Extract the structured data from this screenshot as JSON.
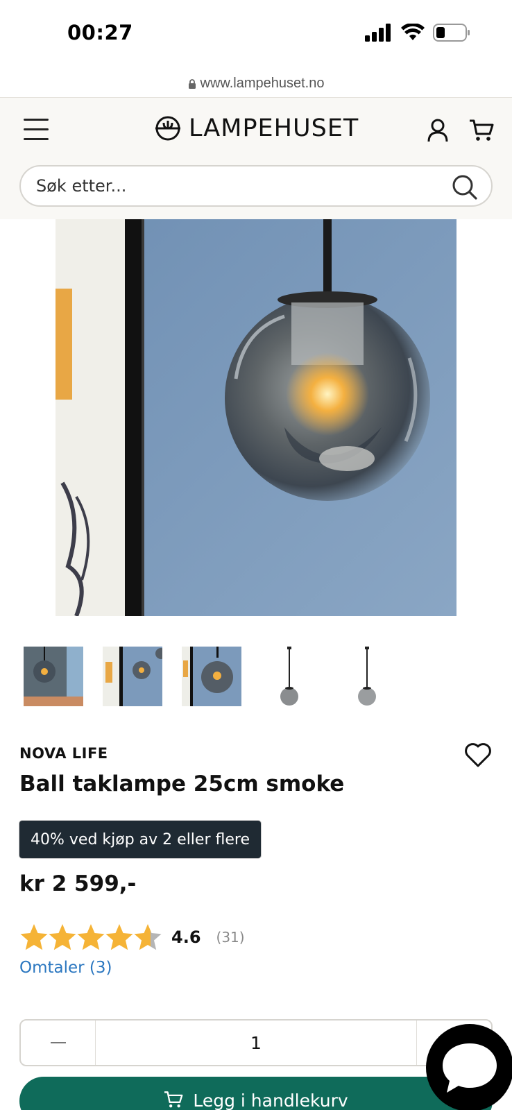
{
  "status_bar": {
    "time": "00:27"
  },
  "browser": {
    "url": "www.lampehuset.no"
  },
  "header": {
    "logo_text": "LAMPEHUSET",
    "search_placeholder": "Søk etter..."
  },
  "product": {
    "brand": "NOVA LIFE",
    "title": "Ball taklampe 25cm smoke",
    "promo": "40% ved kjøp av 2 eller flere",
    "price": "kr 2 599,-",
    "rating": {
      "value": "4.6",
      "stars": 4.6,
      "count": "(31)"
    },
    "reviews_link": "Omtaler (3)",
    "quantity": "1",
    "add_to_cart": "Legg i handlekurv",
    "thumbnails": [
      "thumb-1",
      "thumb-2",
      "thumb-3",
      "thumb-4",
      "thumb-5"
    ]
  },
  "colors": {
    "header_bg": "#f9f8f5",
    "promo_bg": "#1f2a33",
    "cart_button": "#0f6b5a",
    "link": "#2b77c0",
    "star": "#f5b336"
  },
  "icons": [
    "lock-icon",
    "menu-icon",
    "logo-icon",
    "account-icon",
    "cart-icon",
    "search-icon",
    "heart-icon",
    "star-icon",
    "minus-icon",
    "chat-icon"
  ]
}
